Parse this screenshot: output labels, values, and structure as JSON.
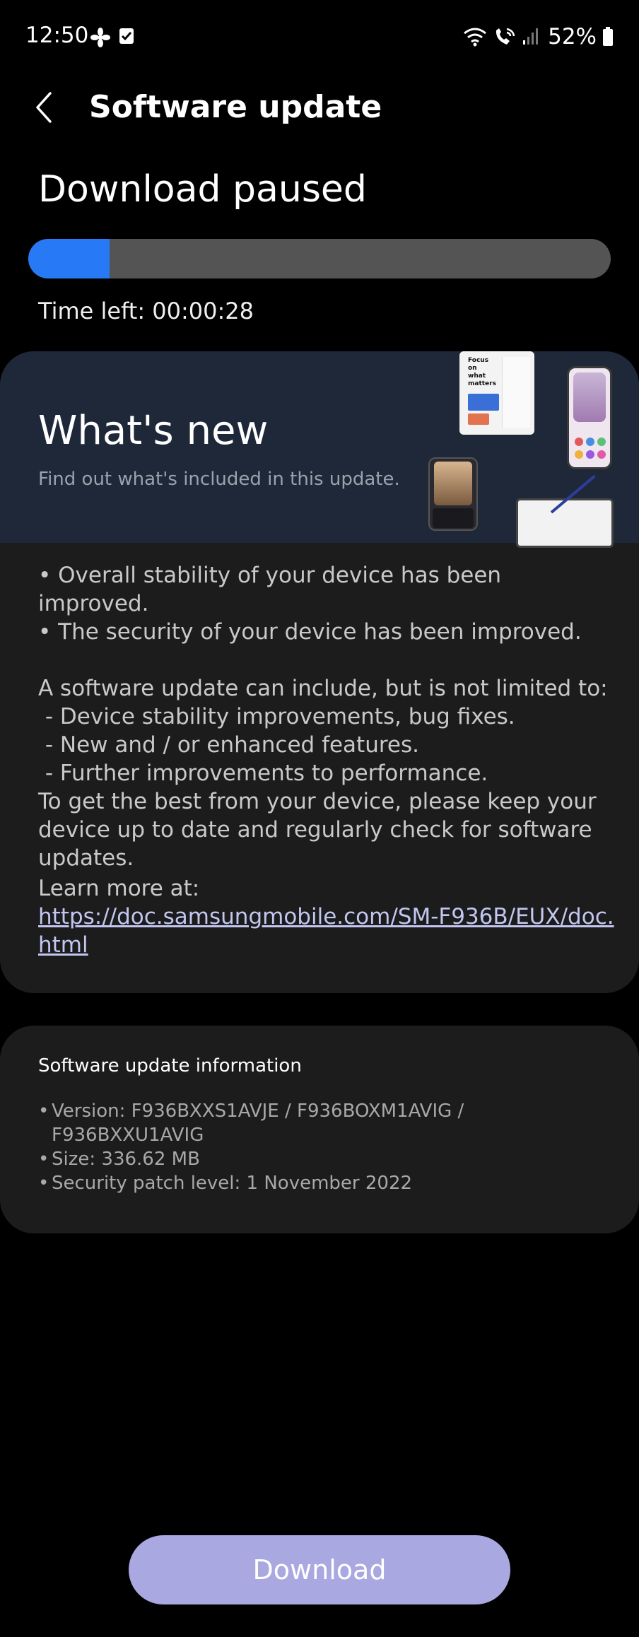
{
  "status_bar": {
    "time": "12:50",
    "battery": "52%",
    "icons": [
      "fan-icon",
      "checkbox-notification-icon",
      "wifi-icon",
      "wifi-calling-icon",
      "signal-icon",
      "battery-icon"
    ]
  },
  "app_bar": {
    "title": "Software update",
    "back_icon": "chevron-left-icon"
  },
  "download": {
    "status": "Download paused",
    "progress_fraction": 0.14,
    "time_left": "Time left: 00:00:28",
    "accent_color": "#2879f5"
  },
  "whats_new": {
    "title": "What's new",
    "subtitle": "Find out what's included in this update.",
    "illustration_headline": "Focus on what matters",
    "release_notes": "• Overall stability of your device has been improved.\n• The security of your device has been improved.\n\nA software update can include, but is not limited to:\n - Device stability improvements, bug fixes.\n - New and / or enhanced features.\n - Further improvements to performance.\nTo get the best from your device, please keep your device up to date and regularly check for software updates.",
    "learn_more_label": "Learn more at:",
    "learn_more_link": "https://doc.samsungmobile.com/SM-F936B/EUX/doc.html"
  },
  "update_info": {
    "title": "Software update information",
    "items": [
      "Version: F936BXXS1AVJE / F936BOXM1AVIG / F936BXXU1AVIG",
      "Size: 336.62 MB",
      "Security patch level: 1 November 2022"
    ]
  },
  "actions": {
    "download_label": "Download",
    "button_color": "#a9a8e0"
  }
}
